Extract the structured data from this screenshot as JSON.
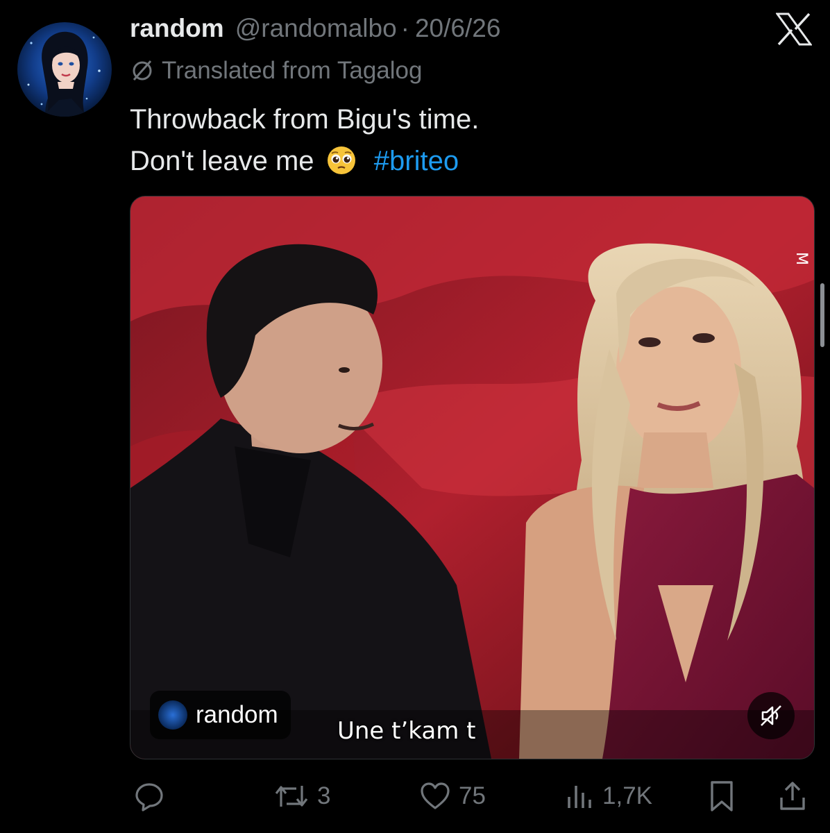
{
  "post": {
    "display_name": "random",
    "handle": "@randomalbo",
    "separator": "·",
    "date": "20/6/26",
    "translated_label": "Translated from Tagalog",
    "text_line1": "Throwback from Bigu's time.",
    "text_line2_prefix": "Don't leave me",
    "emoji": "pleading-face",
    "hashtag": "#briteo"
  },
  "media": {
    "watermark_label": "random",
    "subtitle": "Une t’kam t",
    "side_glyph": "M"
  },
  "actions": {
    "reply_count": "",
    "repost_count": "3",
    "like_count": "75",
    "views_count": "1,7K"
  },
  "icons": {
    "close": "x-logo-icon",
    "translate": "globe-slash-icon",
    "reply": "reply-icon",
    "repost": "repost-icon",
    "like": "heart-icon",
    "views": "views-icon",
    "bookmark": "bookmark-icon",
    "share": "share-icon",
    "mute": "muted-speaker-icon"
  },
  "colors": {
    "background": "#000000",
    "text": "#e7e9ea",
    "muted": "#71767b",
    "accent": "#1d9bf0"
  }
}
